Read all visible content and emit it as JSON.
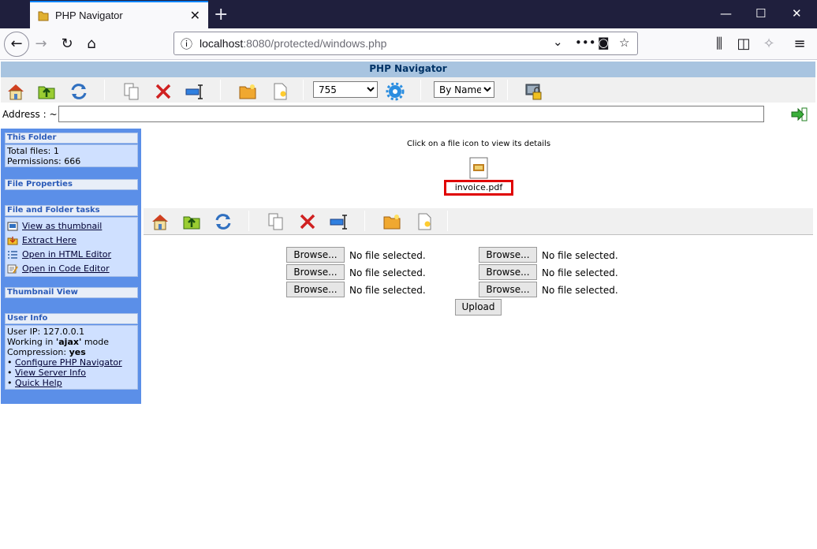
{
  "browser": {
    "tab_title": "PHP Navigator",
    "tab_close": "✕",
    "new_tab": "+",
    "url_host": "localhost",
    "url_path": ":8080/protected/windows.php",
    "win_min": "—",
    "win_max": "☐",
    "win_close": "✕"
  },
  "app": {
    "title": "PHP Navigator",
    "toolbar": {
      "permission_value": "755",
      "permission_options": [
        "755"
      ],
      "sort_value": "By Name",
      "sort_options": [
        "By Name"
      ]
    },
    "address_label": "Address : ~",
    "address_value": ""
  },
  "sidebar": {
    "this_folder": {
      "header": "This Folder",
      "total_files": "Total files: 1",
      "permissions": "Permissions: 666"
    },
    "file_properties": {
      "header": "File Properties"
    },
    "tasks": {
      "header": "File and Folder tasks",
      "items": [
        "View as thumbnail",
        "Extract Here",
        "Open in HTML Editor",
        "Open in Code Editor"
      ]
    },
    "thumbnail_view": {
      "header": "Thumbnail View"
    },
    "user_info": {
      "header": "User Info",
      "ip": "User IP: 127.0.0.1",
      "mode_prefix": "Working in ",
      "mode_value": "'ajax'",
      "mode_suffix": " mode",
      "compression_label": "Compression: ",
      "compression_value": "yes",
      "links": [
        "Configure PHP Navigator",
        "View Server Info",
        "Quick Help"
      ]
    }
  },
  "main": {
    "hint": "Click on a file icon to view its details",
    "file_name": "invoice.pdf",
    "upload": {
      "browse_label": "Browse...",
      "no_file_text": "No file selected.",
      "upload_label": "Upload"
    }
  },
  "colors": {
    "sidebar_bg": "#5b8fe8",
    "header_bg": "#a8c4e0",
    "highlight": "#e00000"
  }
}
